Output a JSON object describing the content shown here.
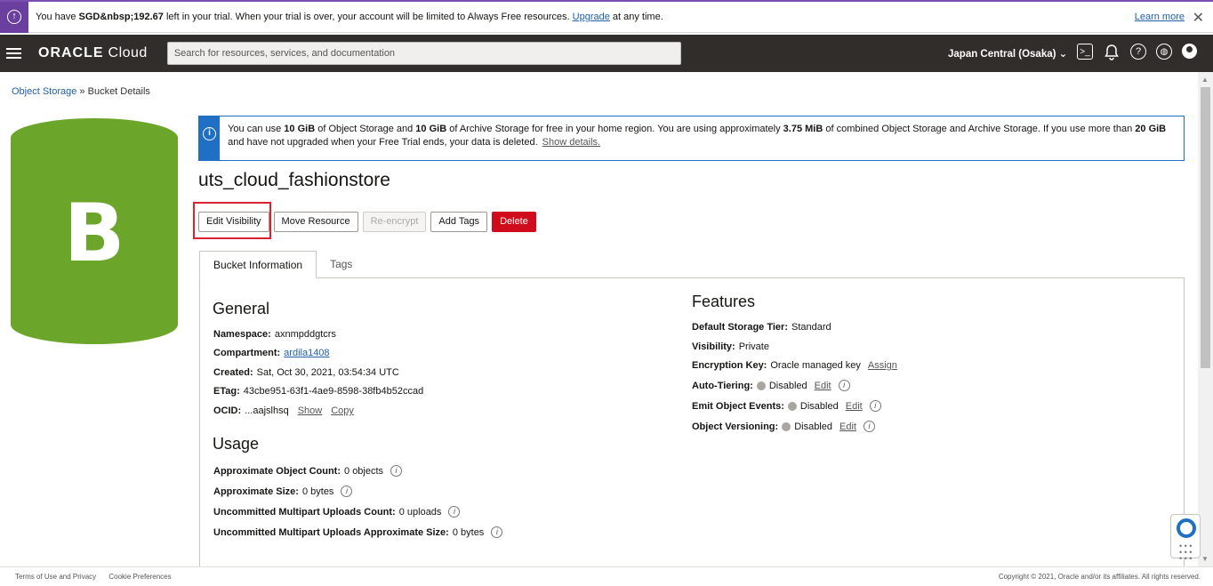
{
  "trial_banner": {
    "message_prefix": "You have ",
    "amount": "SGD&nbsp;192.67",
    "message_mid": " left in your trial. When your trial is over, your account will be limited to Always Free resources. ",
    "upgrade_link": "Upgrade",
    "message_suffix": " at any time.",
    "learn_more": "Learn more",
    "close": "✕"
  },
  "header": {
    "logo_bold": "ORACLE",
    "logo_rest": " Cloud",
    "search_placeholder": "Search for resources, services, and documentation",
    "region": "Japan Central (Osaka) ⌄"
  },
  "breadcrumb": {
    "root": "Object Storage",
    "separator": " » ",
    "current": "Bucket Details"
  },
  "bucket_icon_letter": "B",
  "info_box": {
    "t1": "You can use ",
    "b1": "10 GiB",
    "t2": " of Object Storage and ",
    "b2": "10 GiB",
    "t3": " of Archive Storage for free in your home region. You are using approximately ",
    "b3": "3.75 MiB",
    "t4": " of combined Object Storage and Archive Storage. If you use more than ",
    "b4": "20 GiB",
    "t5": " and have not upgraded when your Free Trial ends, your data is deleted.",
    "link": "Show details."
  },
  "bucket_name": "uts_cloud_fashionstore",
  "actions": {
    "edit_visibility": "Edit Visibility",
    "move_resource": "Move Resource",
    "re_encrypt": "Re-encrypt",
    "add_tags": "Add Tags",
    "delete": "Delete"
  },
  "tabs": {
    "bucket_information": "Bucket Information",
    "tags": "Tags"
  },
  "general": {
    "heading": "General",
    "namespace_label": "Namespace:",
    "namespace": "axnmpddgtcrs",
    "compartment_label": "Compartment:",
    "compartment": "ardila1408",
    "created_label": "Created:",
    "created": "Sat, Oct 30, 2021, 03:54:34 UTC",
    "etag_label": "ETag:",
    "etag": "43cbe951-63f1-4ae9-8598-38fb4b52ccad",
    "ocid_label": "OCID:",
    "ocid": "...aajslhsq",
    "show": "Show",
    "copy": "Copy"
  },
  "usage": {
    "heading": "Usage",
    "object_count_label": "Approximate Object Count:",
    "object_count": "0 objects",
    "size_label": "Approximate Size:",
    "size": "0 bytes",
    "multipart_count_label": "Uncommitted Multipart Uploads Count:",
    "multipart_count": "0 uploads",
    "multipart_size_label": "Uncommitted Multipart Uploads Approximate Size:",
    "multipart_size": "0 bytes"
  },
  "features": {
    "heading": "Features",
    "storage_tier_label": "Default Storage Tier:",
    "storage_tier": "Standard",
    "visibility_label": "Visibility:",
    "visibility": "Private",
    "encryption_label": "Encryption Key:",
    "encryption": "Oracle managed key",
    "assign": "Assign",
    "auto_tiering_label": "Auto-Tiering:",
    "auto_tiering": "Disabled",
    "emit_events_label": "Emit Object Events:",
    "emit_events": "Disabled",
    "versioning_label": "Object Versioning:",
    "versioning": "Disabled",
    "edit": "Edit"
  },
  "footer": {
    "terms": "Terms of Use and Privacy",
    "cookies": "Cookie Preferences",
    "copyright": "Copyright © 2021, Oracle and/or its affiliates. All rights reserved."
  },
  "colors": {
    "bucket_green": "#6ba62a",
    "delete_red": "#d00b1c",
    "info_blue": "#1f6fc4",
    "header_dark": "#312d2a",
    "highlight_box": "#d9232e"
  }
}
